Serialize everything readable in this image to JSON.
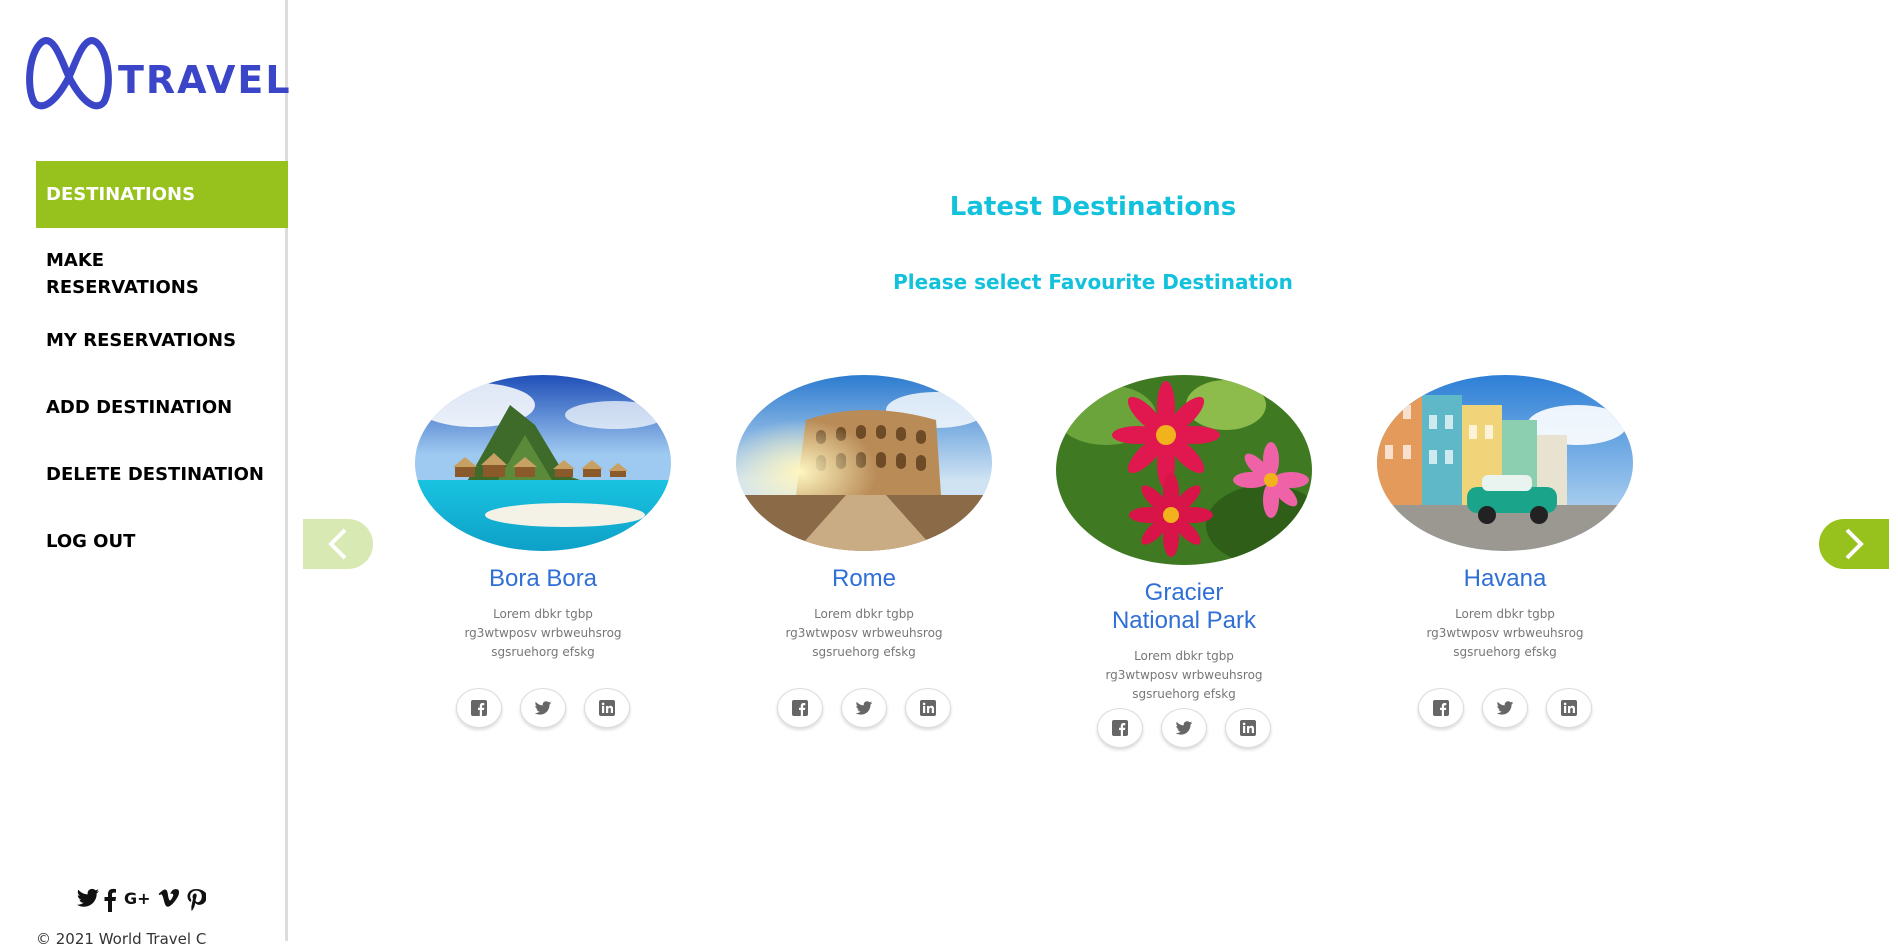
{
  "brand": {
    "name": "TRAVEL",
    "color": "#3a45c8"
  },
  "sidebar": {
    "items": [
      {
        "label": "DESTINATIONS",
        "active": true
      },
      {
        "label": "MAKE RESERVATIONS"
      },
      {
        "label": "MY RESERVATIONS"
      },
      {
        "label": "ADD DESTINATION"
      },
      {
        "label": "DELETE DESTINATION"
      },
      {
        "label": "LOG OUT"
      }
    ],
    "social_icons": [
      "twitter-icon",
      "facebook-icon",
      "google-plus-icon",
      "vimeo-icon",
      "pinterest-icon"
    ],
    "copyright": "© 2021 World Travel C"
  },
  "main": {
    "title": "Latest Destinations",
    "subtitle": "Please select Favourite Destination",
    "cards": [
      {
        "name": "Bora Bora",
        "description": "Lorem dbkr tgbp rg3wtwposv wrbweuhsrog sgsruehorg efskg"
      },
      {
        "name": "Rome",
        "description": "Lorem dbkr tgbp rg3wtwposv wrbweuhsrog sgsruehorg efskg"
      },
      {
        "name": "Gracier National Park",
        "description": "Lorem dbkr tgbp rg3wtwposv wrbweuhsrog sgsruehorg efskg"
      },
      {
        "name": "Havana",
        "description": "Lorem dbkr tgbp rg3wtwposv wrbweuhsrog sgsruehorg efskg"
      }
    ],
    "card_icons": [
      "facebook-icon",
      "twitter-icon",
      "linkedin-icon"
    ]
  },
  "colors": {
    "accent": "#97c11c",
    "accent_light": "#d9e9b3",
    "heading": "#12c1dc",
    "card_title": "#2f6fd6"
  }
}
